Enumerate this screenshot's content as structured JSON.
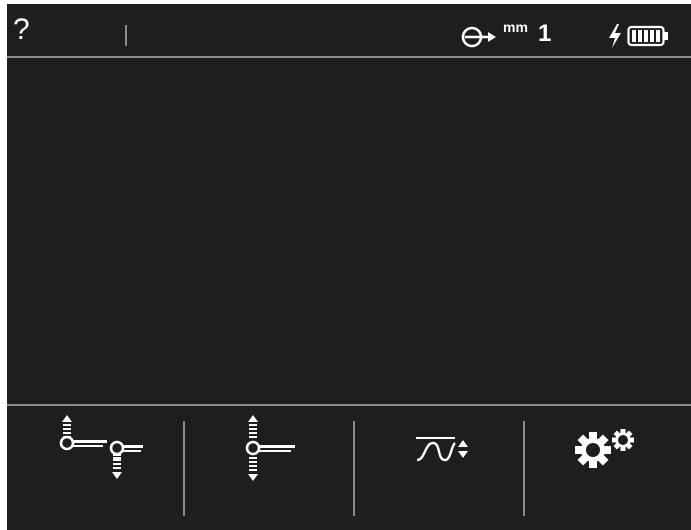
{
  "status_bar": {
    "help_label": "?",
    "probe_icon": "probe-arrow-icon",
    "unit_label": "mm",
    "unit_value": "1",
    "charging_icon": "lightning-bolt-icon",
    "battery_icon": "battery-full-icon"
  },
  "softkeys": [
    {
      "icon": "dual-probe-up-down-icon"
    },
    {
      "icon": "probe-up-down-icon"
    },
    {
      "icon": "wave-adjust-icon"
    },
    {
      "icon": "settings-gears-icon"
    }
  ],
  "colors": {
    "background": "#1e1e1e",
    "foreground": "#ffffff",
    "divider": "#8a8a8a"
  }
}
